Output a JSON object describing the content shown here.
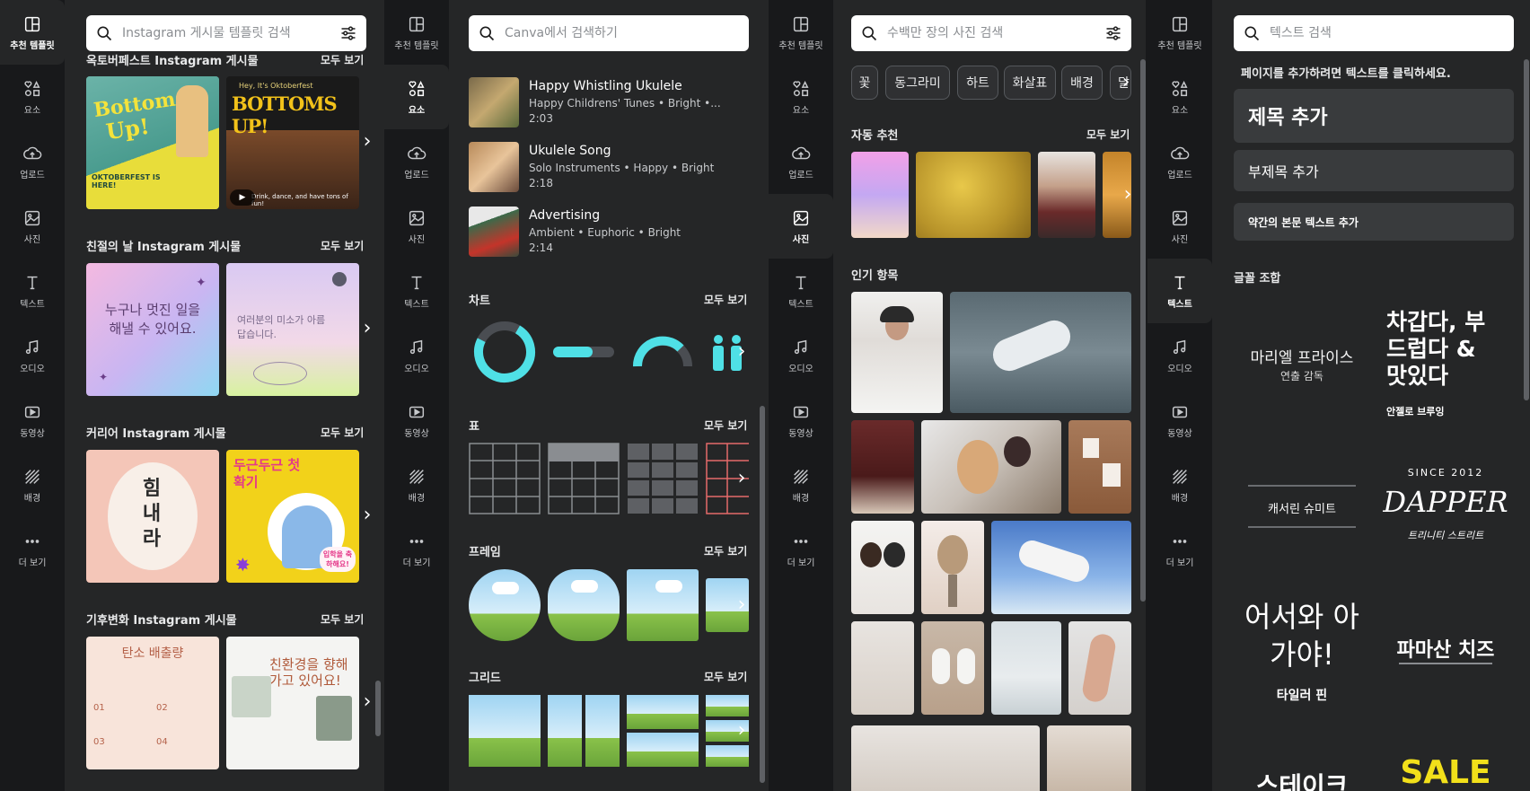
{
  "rail": {
    "items": [
      {
        "label": "추천 템플릿",
        "icon": "template-icon"
      },
      {
        "label": "요소",
        "icon": "elements-icon"
      },
      {
        "label": "업로드",
        "icon": "upload-icon"
      },
      {
        "label": "사진",
        "icon": "photo-icon"
      },
      {
        "label": "텍스트",
        "icon": "text-icon"
      },
      {
        "label": "오디오",
        "icon": "audio-icon"
      },
      {
        "label": "동영상",
        "icon": "video-icon"
      },
      {
        "label": "배경",
        "icon": "background-icon"
      },
      {
        "label": "더 보기",
        "icon": "more-icon"
      }
    ]
  },
  "templates": {
    "search_placeholder": "Instagram 게시물 템플릿 검색",
    "see_all": "모두 보기",
    "sections": [
      {
        "title": "옥토버페스트 Instagram 게시물"
      },
      {
        "title": "친절의 날 Instagram 게시물"
      },
      {
        "title": "커리어 Instagram 게시물"
      },
      {
        "title": "기후변화 Instagram 게시물"
      }
    ],
    "thumbs": {
      "oktober1_top": "Bottoms",
      "oktober1_bottom": "Up!",
      "oktober1_sub": "OKTOBERFEST IS HERE!",
      "oktober2_top": "Hey, It's Oktoberfest",
      "oktober2_main": "BOTTOMS UP!",
      "oktober2_sub": "Drink, dance, and have tons of fun!",
      "kind1": "누구나 멋진 일을 해낼 수 있어요.",
      "kind2": "여러분의 미소가 아름답습니다.",
      "career1": "힘 내 라",
      "career2_title": "두근두근 첫확기",
      "career2_badge": "입학을 축하해요!",
      "climate1_title": "탄소 배출량",
      "climate2_title": "친환경을 향해 가고 있어요!"
    }
  },
  "elements": {
    "search_placeholder": "Canva에서 검색하기",
    "see_all": "모두 보기",
    "audio": [
      {
        "title": "Happy Whistling Ukulele",
        "meta": "Happy Childrens' Tunes • Bright •...",
        "duration": "2:03"
      },
      {
        "title": "Ukulele Song",
        "meta": "Solo Instruments • Happy • Bright",
        "duration": "2:18"
      },
      {
        "title": "Advertising",
        "meta": "Ambient • Euphoric • Bright",
        "duration": "2:14"
      }
    ],
    "sections": {
      "charts": "차트",
      "tables": "표",
      "frames": "프레임",
      "grids": "그리드"
    }
  },
  "photos": {
    "search_placeholder": "수백만 장의 사진 검색",
    "chips": [
      "꽃",
      "동그라미",
      "하트",
      "화살표",
      "배경",
      "달"
    ],
    "auto_title": "자동 추천",
    "popular_title": "인기 항목",
    "see_all": "모두 보기"
  },
  "text": {
    "search_placeholder": "텍스트 검색",
    "hint": "페이지를 추가하려면 텍스트를 클릭하세요.",
    "add_heading": "제목 추가",
    "add_subheading": "부제목 추가",
    "add_body": "약간의 본문 텍스트 추가",
    "combos_title": "글꼴 조합",
    "combos": {
      "c1_main": "마리엘 프라이스",
      "c1_sub": "연출 감독",
      "c2_main": "차갑다, 부드럽다 & 맛있다",
      "c2_sub": "안젤로 브루잉",
      "c3_main": "캐서린 슈미트",
      "c4_top": "SINCE 2012",
      "c4_main": "DAPPER",
      "c4_sub": "트리니티 스트리트",
      "c5_main": "어서와 아가야!",
      "c5_sub": "타일러 핀",
      "c6_main": "파마산 치즈",
      "c7_main": "스테이크",
      "c8_main": "SALE"
    }
  }
}
